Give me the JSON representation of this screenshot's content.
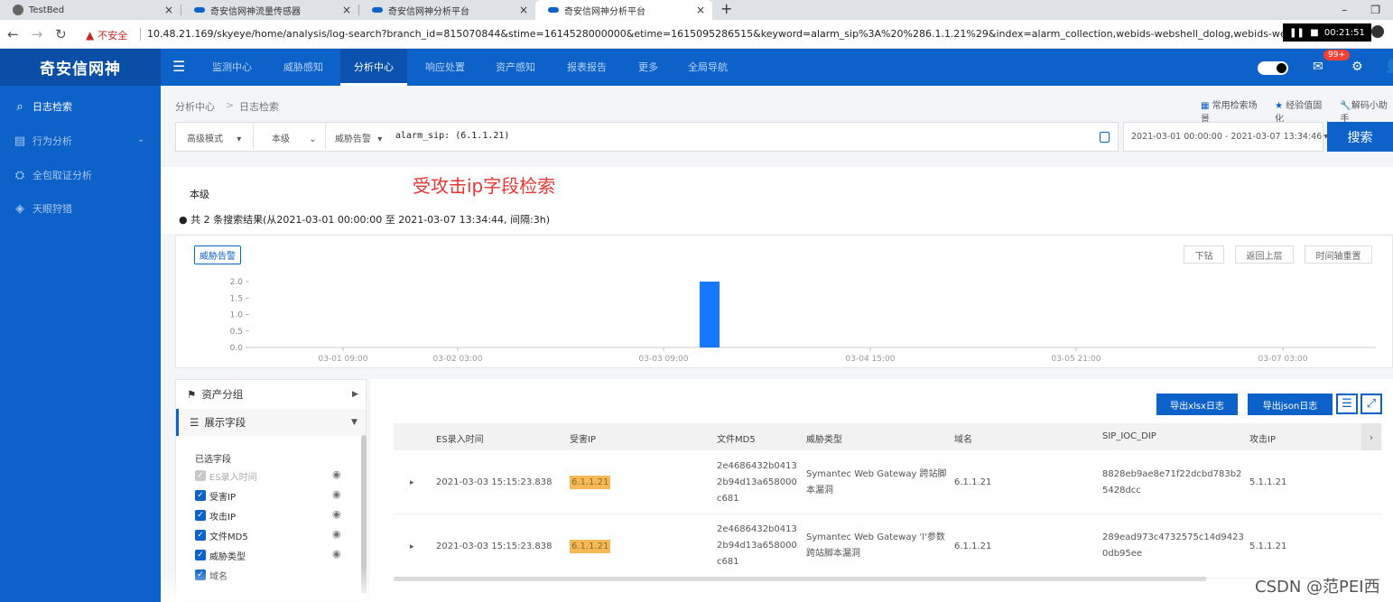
{
  "browser": {
    "tabs": [
      {
        "title": "TestBed"
      },
      {
        "title": "奇安信网神流量传感器"
      },
      {
        "title": "奇安信网神分析平台"
      },
      {
        "title": "奇安信网神分析平台"
      }
    ],
    "security_warning": "不安全",
    "url": "10.48.21.169/skyeye/home/analysis/log-search?branch_id=815070844&stime=1614528000000&etime=1615095286515&keyword=alarm_sip%3A%20%286.1.1.21%29&index=alarm_collection,webids-webshell_dolog,webids-webatta",
    "recording_time": "00:21:51"
  },
  "app": {
    "logo": "奇安信网神",
    "nav": [
      "监测中心",
      "威胁感知",
      "分析中心",
      "响应处置",
      "资产感知",
      "报表报告",
      "更多",
      "全局导航"
    ],
    "notification_badge": "99+"
  },
  "sidebar": {
    "items": [
      {
        "label": "日志检索",
        "icon": "search-icon"
      },
      {
        "label": "行为分析",
        "icon": "behavior-icon"
      },
      {
        "label": "全包取证分析",
        "icon": "packet-icon"
      },
      {
        "label": "天眼狩猎",
        "icon": "hunting-icon"
      }
    ]
  },
  "breadcrumb": {
    "parent": "分析中心",
    "current": "日志检索"
  },
  "quick_links": [
    "常用检索场景",
    "经验值固化",
    "解码小助手"
  ],
  "search": {
    "mode": "高级模式",
    "scope": "本级",
    "index": "威胁告警",
    "query": "alarm_sip: (6.1.1.21)",
    "date_range": "2021-03-01 00:00:00 - 2021-03-07 13:34:46",
    "button": "搜索"
  },
  "results": {
    "scope_label": "本级",
    "annotation": "受攻击ip字段检索",
    "summary": "共 2 条搜索结果(从2021-03-01 00:00:00 至 2021-03-07 13:34:44, 间隔:3h)"
  },
  "chart_buttons": [
    "下钻",
    "返回上层",
    "时间轴重置"
  ],
  "chart_data": {
    "type": "bar",
    "series": [
      {
        "name": "威胁告警",
        "values": [
          {
            "x": "03-03 15:00",
            "y": 2
          }
        ]
      }
    ],
    "x_ticks": [
      "03-01 09:00",
      "03-02 03:00",
      "03-03 09:00",
      "03-04 15:00",
      "03-05 21:00",
      "03-07 03:00"
    ],
    "y_ticks": [
      "0.0",
      "0.5",
      "1.0",
      "1.5",
      "2.0"
    ],
    "ylim": [
      0,
      2
    ],
    "color": "#1677ff"
  },
  "left_panel": {
    "asset_group": "资产分组",
    "display_fields": "展示字段",
    "selected_label": "已选字段",
    "fields": [
      {
        "label": "ES录入时间",
        "disabled": true
      },
      {
        "label": "受害IP",
        "disabled": false
      },
      {
        "label": "攻击IP",
        "disabled": false
      },
      {
        "label": "文件MD5",
        "disabled": false
      },
      {
        "label": "威胁类型",
        "disabled": false
      },
      {
        "label": "域名",
        "disabled": false
      }
    ]
  },
  "table": {
    "export_xlsx": "导出xlsx日志",
    "export_json": "导出json日志",
    "columns": [
      "ES录入时间",
      "受害IP",
      "文件MD5",
      "威胁类型",
      "域名",
      "SIP_IOC_DIP",
      "攻击IP"
    ],
    "rows": [
      {
        "time": "2021-03-03 15:15:23.838",
        "victim_ip": "6.1.1.21",
        "md5": [
          "2e4686432b0413",
          "2b94d13a658000",
          "c681"
        ],
        "threat": [
          "Symantec Web Gateway 跨站脚",
          "本漏洞"
        ],
        "domain": "6.1.1.21",
        "sip_ioc_dip": [
          "8828eb9ae8e71f22dcbd783b2",
          "5428dcc"
        ],
        "attack_ip": "5.1.1.21"
      },
      {
        "time": "2021-03-03 15:15:23.838",
        "victim_ip": "6.1.1.21",
        "md5": [
          "2e4686432b0413",
          "2b94d13a658000",
          "c681"
        ],
        "threat": [
          "Symantec Web Gateway 'l'参数",
          "跨站脚本漏洞"
        ],
        "domain": "6.1.1.21",
        "sip_ioc_dip": [
          "289ead973c4732575c14d9423",
          "0db95ee"
        ],
        "attack_ip": "5.1.1.21"
      }
    ]
  },
  "watermark": "CSDN @范PEI西"
}
